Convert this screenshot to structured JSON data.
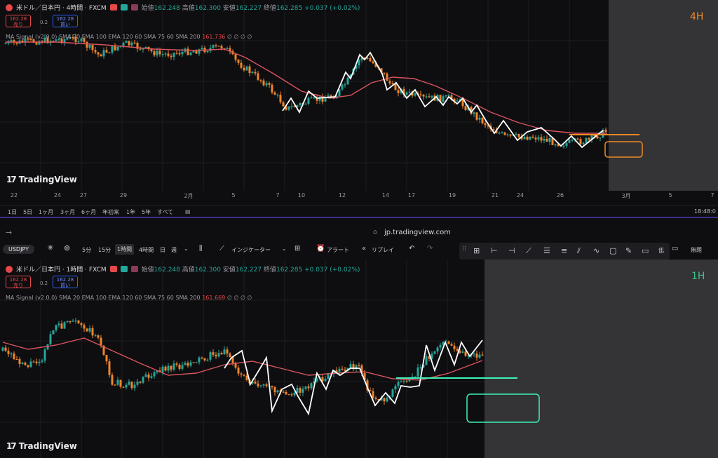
{
  "top_chart": {
    "symbol_title": "米ドル／日本円 · 4時間 · FXCM",
    "ohlc": {
      "open_label": "始値",
      "open": "162.248",
      "high_label": "高値",
      "high": "162.300",
      "low_label": "安値",
      "low": "162.227",
      "close_label": "終値",
      "close": "162.285",
      "change": "+0.037 (+0.02%)"
    },
    "sell_price": "162.28",
    "sell_label": "売り",
    "spread": "0.2",
    "buy_price": "162.28",
    "buy_label": "買い",
    "indicator": "MA Signal (v2.0.0) SMA 20 EMA 100 EMA 120 60 SMA 75 60 SMA 200",
    "indicator_value": "161.736",
    "indicator_tail": "∅ ∅ ∅ ∅",
    "timeframe": "4H",
    "logo": "TradingView",
    "x_ticks": [
      "22",
      "24",
      "27",
      "29",
      "2月",
      "5",
      "7",
      "10",
      "12",
      "14",
      "17",
      "19",
      "21",
      "24",
      "26",
      "3月",
      "5",
      "7"
    ],
    "range_buttons": [
      "1日",
      "5日",
      "1ヶ月",
      "3ヶ月",
      "6ヶ月",
      "年初来",
      "1年",
      "5年",
      "すべて"
    ],
    "clock": "18:48:0"
  },
  "url_bar": {
    "url": "jp.tradingview.com",
    "back_icon": "arrow-right-icon"
  },
  "toolbar": {
    "symbol": "USDJPY",
    "intervals": [
      "5分",
      "15分",
      "1時間",
      "4時間",
      "日",
      "週"
    ],
    "indicators": "インジケーター",
    "alert": "アラート",
    "replay": "リプレイ",
    "untitled": "無題"
  },
  "bottom_chart": {
    "symbol_title": "米ドル／日本円 · 1時間 · FXCM",
    "ohlc": {
      "open_label": "始値",
      "open": "162.248",
      "high_label": "高値",
      "high": "162.300",
      "low_label": "安値",
      "low": "162.227",
      "close_label": "終値",
      "close": "162.285",
      "change": "+0.037 (+0.02%)"
    },
    "sell_price": "162.28",
    "sell_label": "売り",
    "spread": "0.2",
    "buy_price": "162.28",
    "buy_label": "買い",
    "indicator": "MA Signal (v2.0.0) SMA 20 EMA 100 EMA 120 60 SMA 75 60 SMA 200",
    "indicator_value": "161.669",
    "indicator_tail": "∅ ∅ ∅ ∅",
    "timeframe": "1H",
    "logo": "TradingView"
  },
  "colors": {
    "bull": "#26a69a",
    "bear": "#f0842c",
    "ma": "#d9545f",
    "orange": "#f08a24",
    "teal": "#3ff0b8",
    "accent": "#2962ff"
  }
}
